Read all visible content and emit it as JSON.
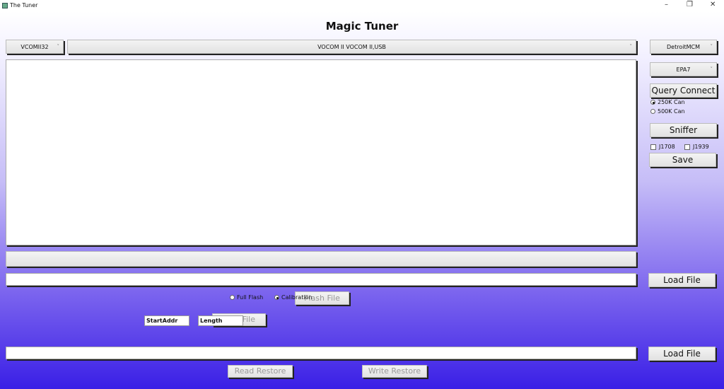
{
  "window": {
    "title": "The Tuner",
    "minimize": "–",
    "restore": "❐",
    "close": "✕"
  },
  "heading": "Magic Tuner",
  "selectors": {
    "interface": "VCOMII32",
    "device": "VOCOM II VOCOM II,USB",
    "ecu": "DetroitMCM",
    "emission": "EPA7"
  },
  "buttons": {
    "query_connect": "Query Connect",
    "sniffer": "Sniffer",
    "save": "Save",
    "load_file_1": "Load File",
    "load_file_2": "Load File",
    "flash_file": "Flash File",
    "read_file": "File",
    "read_restore": "Read Restore",
    "write_restore": "Write Restore"
  },
  "can": {
    "options": [
      "250K Can",
      "500K Can"
    ],
    "selected": "250K Can"
  },
  "protocols": [
    {
      "label": "J1708",
      "checked": false
    },
    {
      "label": "J1939",
      "checked": false
    }
  ],
  "flash_mode": {
    "options": [
      "Full Flash",
      "Calibration"
    ],
    "selected": "Calibration"
  },
  "fields": {
    "start_addr": "StartAddr",
    "length": "Length"
  },
  "paths": {
    "flash_path": "",
    "restore_path": ""
  },
  "progress": 0
}
